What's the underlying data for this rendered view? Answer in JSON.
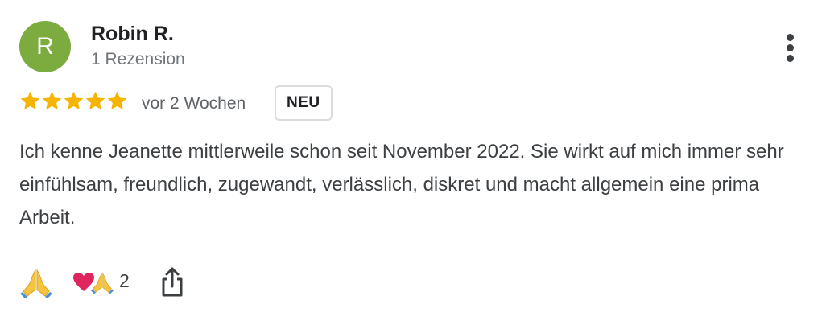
{
  "reviewer": {
    "initial": "R",
    "name": "Robin R.",
    "review_count": "1 Rezension",
    "avatar_color": "#7cab3f"
  },
  "review": {
    "rating": 5,
    "max_rating": 5,
    "star_color": "#f4b400",
    "date": "vor 2 Wochen",
    "badge": "NEU",
    "text": "Ich kenne Jeanette mittlerweile schon seit November 2022. Sie wirkt auf mich immer sehr einfühlsam, freundlich, zugewandt, verlässlich, diskret und macht allgemein eine prima Arbeit."
  },
  "actions": {
    "more_icon": "more-vert-icon",
    "reaction_icon": "folded-hands-icon",
    "reactions_summary_icons": [
      "red-heart-icon",
      "folded-hands-icon"
    ],
    "reaction_count": "2",
    "share_icon": "share-icon"
  }
}
